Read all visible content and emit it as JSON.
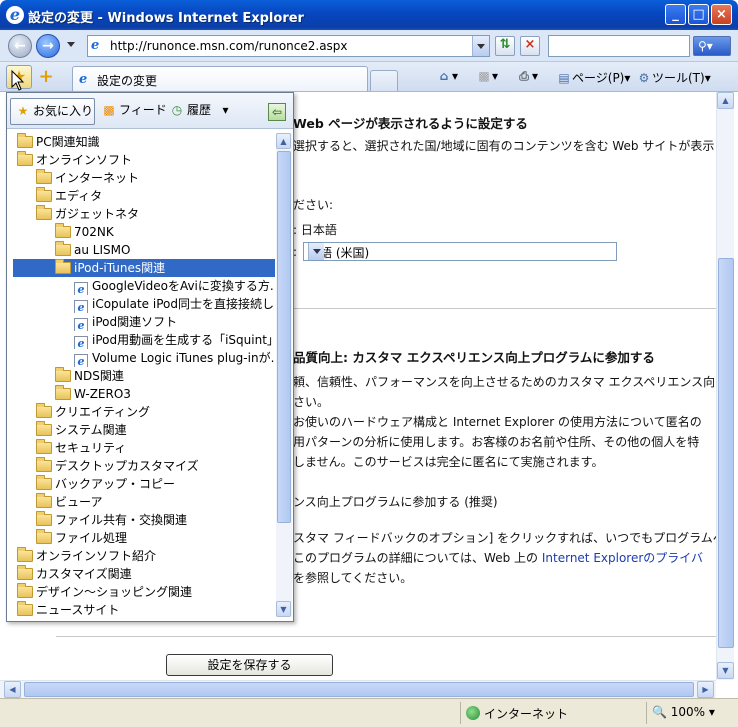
{
  "window": {
    "title": "設定の変更 - Windows Internet Explorer"
  },
  "address": {
    "url": "http://runonce.msn.com/runonce2.aspx",
    "search_placeholder": ""
  },
  "tab": {
    "label": "設定の変更"
  },
  "commands": {
    "page": "ページ(P)",
    "tools": "ツール(T)"
  },
  "content": {
    "heading1": "Web ページが表示されるように設定する",
    "text1": "選択すると、選択された国/地域に固有のコンテンツを含む Web サイトが表示さ",
    "text2": "ださい:",
    "text3": ": 日本語",
    "text4": ":",
    "lang_select": "英語 (米国)",
    "heading2": "品質向上: カスタマ エクスペリエンス向上プログラムに参加する",
    "p1": "頼、信頼性、パフォーマンスを向上させるためのカスタマ エクスペリエンス向",
    "p2": "さい。",
    "p3": "お使いのハードウェア構成と Internet Explorer の使用方法について匿名の",
    "p4": "用パターンの分析に使用します。お客様のお名前や住所、その他の個人を特",
    "p5": "しません。このサービスは完全に匿名にて実施されます。",
    "p6": "ンス向上プログラムに参加する (推奨)",
    "p7": "スタマ フィードバックのオプション] をクリックすれば、いつでもプログラムへ",
    "p8a": "このプログラムの詳細については、Web 上の",
    "p8link": "Internet Explorerのプライバ",
    "p9": "を参照してください。",
    "save_button": "設定を保存する"
  },
  "status": {
    "zone": "インターネット",
    "zoom": "100%"
  },
  "favorites": {
    "tabs": {
      "favorites": "お気に入り",
      "feeds": "フィード",
      "history": "履歴"
    },
    "items": [
      {
        "label": "PC関連知識",
        "type": "folder",
        "indent": 0
      },
      {
        "label": "オンラインソフト",
        "type": "folder",
        "indent": 0
      },
      {
        "label": "インターネット",
        "type": "folder",
        "indent": 1
      },
      {
        "label": "エディタ",
        "type": "folder",
        "indent": 1
      },
      {
        "label": "ガジェットネタ",
        "type": "folder",
        "indent": 1
      },
      {
        "label": "702NK",
        "type": "folder",
        "indent": 2
      },
      {
        "label": "au LISMO",
        "type": "folder",
        "indent": 2
      },
      {
        "label": "iPod-iTunes関連",
        "type": "folder",
        "indent": 2,
        "selected": true
      },
      {
        "label": "GoogleVideoをAviに変換する方...",
        "type": "page",
        "indent": 3
      },
      {
        "label": "iCopulate iPod同士を直接接続し...",
        "type": "page",
        "indent": 3
      },
      {
        "label": "iPod関連ソフト",
        "type": "page",
        "indent": 3
      },
      {
        "label": "iPod用動画を生成する「iSquint」",
        "type": "page",
        "indent": 3
      },
      {
        "label": "Volume Logic iTunes plug-inが...",
        "type": "page",
        "indent": 3
      },
      {
        "label": "NDS関連",
        "type": "folder",
        "indent": 2
      },
      {
        "label": "W-ZERO3",
        "type": "folder",
        "indent": 2
      },
      {
        "label": "クリエイティング",
        "type": "folder",
        "indent": 1
      },
      {
        "label": "システム関連",
        "type": "folder",
        "indent": 1
      },
      {
        "label": "セキュリティ",
        "type": "folder",
        "indent": 1
      },
      {
        "label": "デスクトップカスタマイズ",
        "type": "folder",
        "indent": 1
      },
      {
        "label": "バックアップ・コピー",
        "type": "folder",
        "indent": 1
      },
      {
        "label": "ビューア",
        "type": "folder",
        "indent": 1
      },
      {
        "label": "ファイル共有・交換関連",
        "type": "folder",
        "indent": 1
      },
      {
        "label": "ファイル処理",
        "type": "folder",
        "indent": 1
      },
      {
        "label": "オンラインソフト紹介",
        "type": "folder",
        "indent": 0
      },
      {
        "label": "カスタマイズ関連",
        "type": "folder",
        "indent": 0
      },
      {
        "label": "デザイン～ショッピング関連",
        "type": "folder",
        "indent": 0
      },
      {
        "label": "ニュースサイト",
        "type": "folder",
        "indent": 0
      }
    ]
  }
}
